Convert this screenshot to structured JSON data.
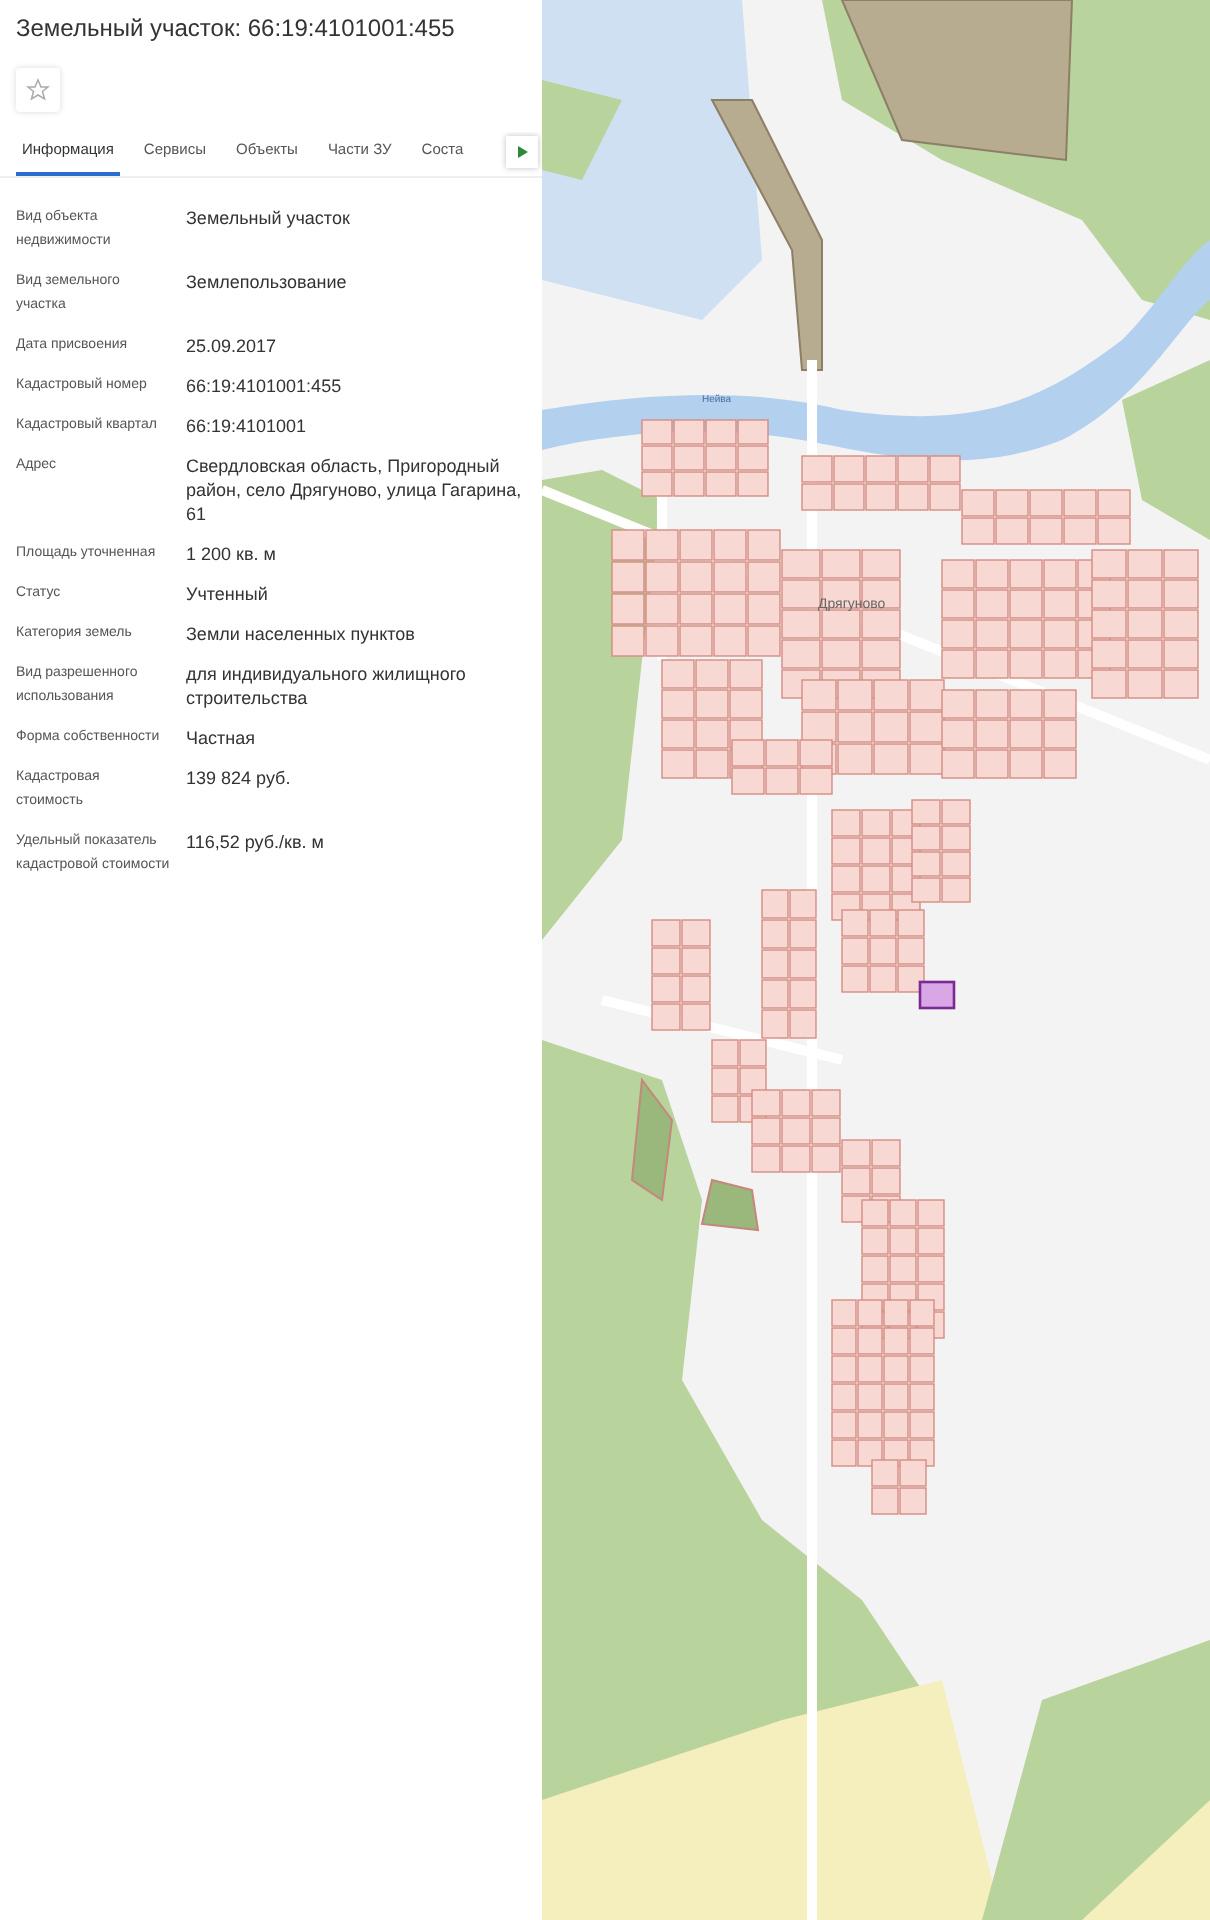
{
  "title": "Земельный участок: 66:19:4101001:455",
  "favorite": {
    "on": false
  },
  "tabs": [
    {
      "label": "Информация",
      "selected": true
    },
    {
      "label": "Сервисы",
      "selected": false
    },
    {
      "label": "Объекты",
      "selected": false
    },
    {
      "label": "Части ЗУ",
      "selected": false
    },
    {
      "label": "Соста",
      "selected": false
    }
  ],
  "fields": [
    {
      "label": "Вид объекта недвижимости",
      "value": "Земельный участок"
    },
    {
      "label": "Вид земельного участка",
      "value": "Землепользование"
    },
    {
      "label": "Дата присвоения",
      "value": "25.09.2017"
    },
    {
      "label": "Кадастровый номер",
      "value": "66:19:4101001:455"
    },
    {
      "label": "Кадастровый квартал",
      "value": "66:19:4101001"
    },
    {
      "label": "Адрес",
      "value": "Свердловская область, Пригородный район, село Дрягуново, улица Гагарина, 61"
    },
    {
      "label": "Площадь уточненная",
      "value": "1 200 кв. м"
    },
    {
      "label": "Статус",
      "value": "Учтенный"
    },
    {
      "label": "Категория земель",
      "value": "Земли населенных пунктов"
    },
    {
      "label": "Вид разрешенного использования",
      "value": "для индивидуального жилищного строительства"
    },
    {
      "label": "Форма собственности",
      "value": "Частная"
    },
    {
      "label": "Кадастровая стоимость",
      "value": "139 824 руб."
    },
    {
      "label": "Удельный показатель кадастровой стоимости",
      "value": "116,52 руб./кв. м"
    }
  ],
  "map": {
    "labels": [
      {
        "kind": "river",
        "text": "Нейва"
      },
      {
        "kind": "village",
        "text": "Дрягуново"
      }
    ]
  }
}
